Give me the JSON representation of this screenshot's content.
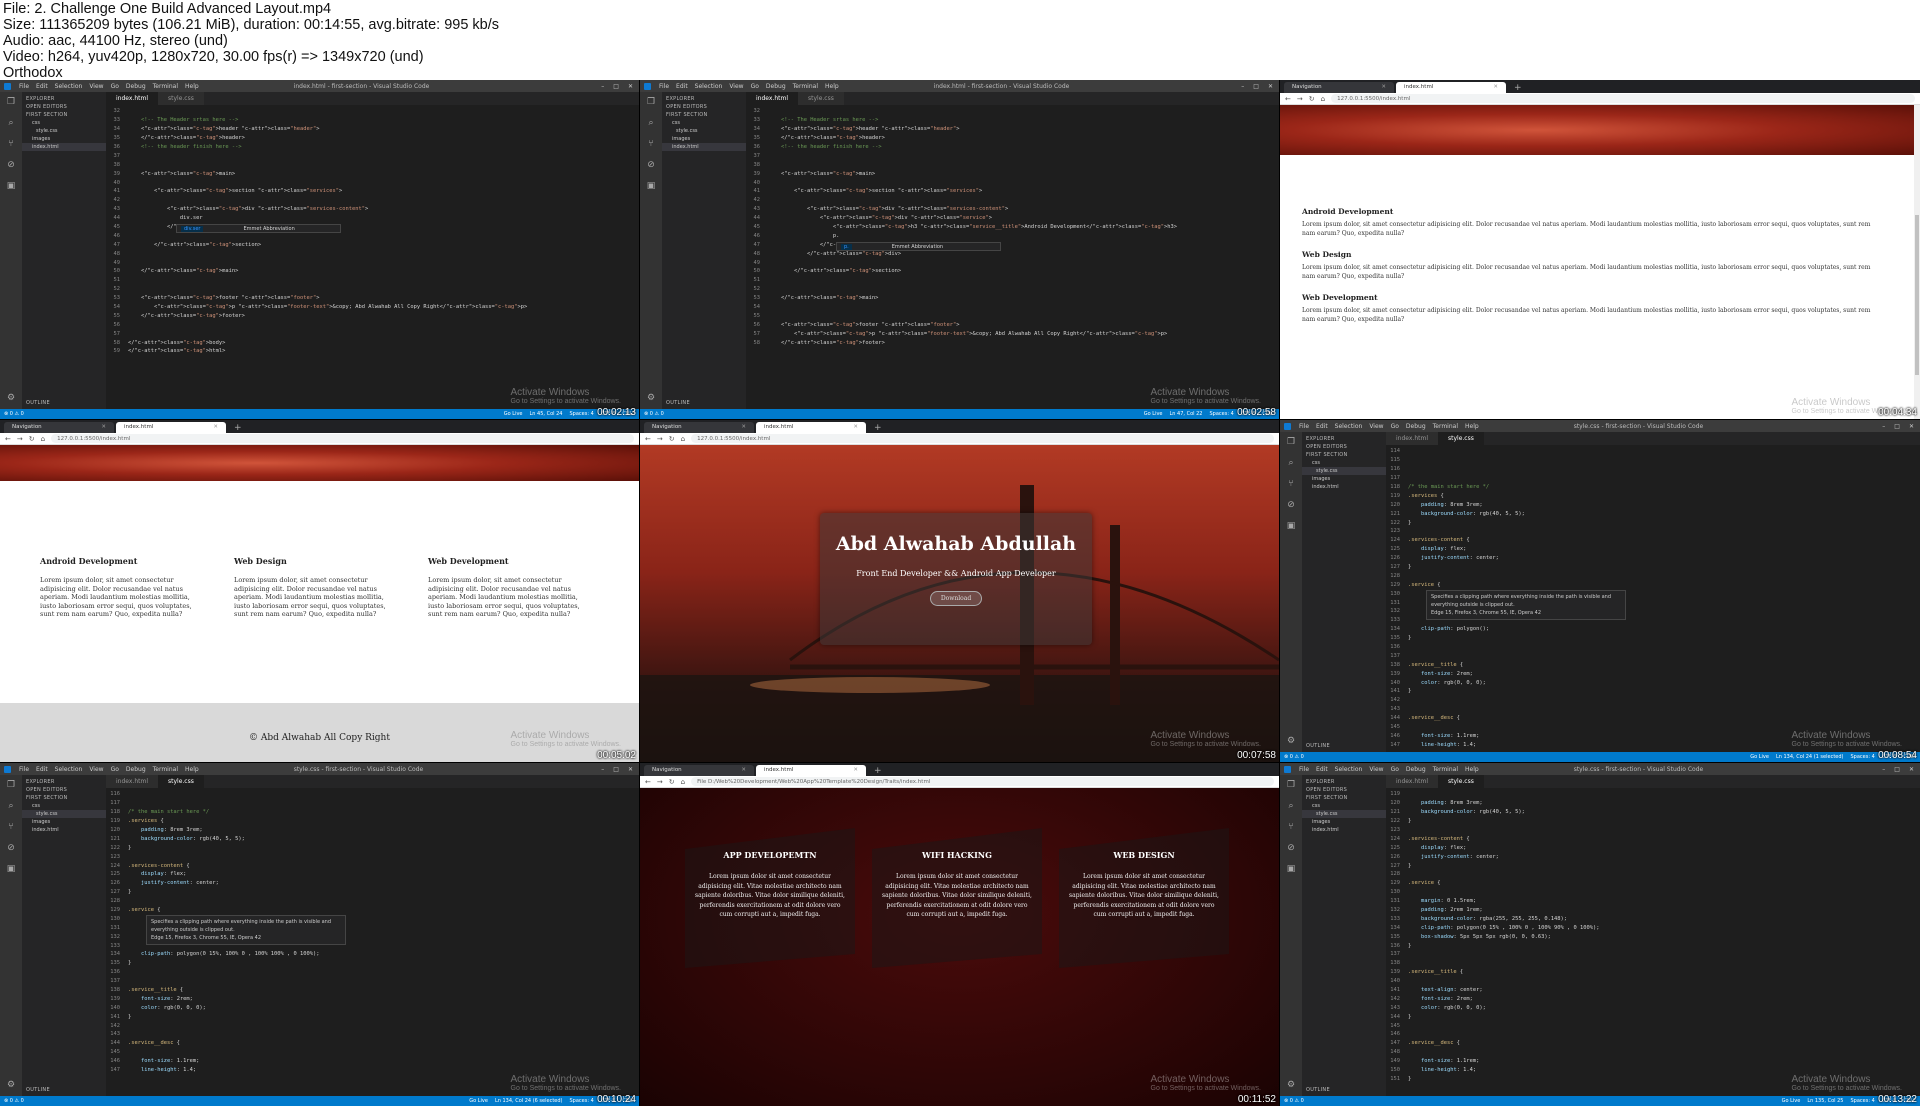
{
  "info": {
    "file": "File: 2. Challenge One Build Advanced Layout.mp4",
    "size": "Size: 111365209 bytes (106.21 MiB), duration: 00:14:55, avg.bitrate: 995 kb/s",
    "audio": "Audio: aac, 44100 Hz, stereo (und)",
    "video": "Video: h264, yuv420p, 1280x720, 30.00 fps(r) => 1349x720 (und)",
    "tag": "Orthodox"
  },
  "common": {
    "vs_menu": [
      "File",
      "Edit",
      "Selection",
      "View",
      "Go",
      "Debug",
      "Terminal",
      "Help"
    ],
    "vs_title_html": "index.html - first-section - Visual Studio Code",
    "vs_title_css": "style.css - first-section - Visual Studio Code",
    "win_controls": [
      "–",
      "□",
      "✕"
    ],
    "explorer": "EXPLORER",
    "open_editors": "OPEN EDITORS",
    "first_section": "FIRST SECTION",
    "css_folder": "css",
    "style_file": "style.css",
    "images_folder": "images",
    "index_file": "index.html",
    "outline": "OUTLINE",
    "tab_index": "index.html",
    "tab_style": "style.css",
    "status_left": "⊗ 0 ⚠ 0",
    "status_golive": "Go Live",
    "status_spaces": "Spaces: 4",
    "status_enc": "UTF-8",
    "status_eol": "CRLF",
    "activate_1": "Activate Windows",
    "activate_2": "Go to Settings to activate Windows.",
    "browser_tab_nav": "Navigation",
    "browser_tab_index": "index.html",
    "url_local": "127.0.0.1:5500/index.html",
    "url_file": "File  D:/Web%20Development/Web%20App%20Template%20Design/Traits/index.html",
    "nav_back": "←",
    "nav_fwd": "→",
    "nav_reload": "↻",
    "nav_home": "⌂",
    "new_tab": "+"
  },
  "timestamps": [
    "00:02:13",
    "00:02:58",
    "00:04:34",
    "00:05:02",
    "00:07:58",
    "00:08:54",
    "00:10:24",
    "00:11:52",
    "00:13:22"
  ],
  "status_cursor": [
    "Ln 45, Col 24",
    "Ln 47, Col 22",
    "Ln 134, Col 24 (1 selected)",
    "Ln 134, Col 24 (6 selected)",
    "Ln 135, Col 25"
  ],
  "editor1": {
    "lines": [
      {
        "n": "32",
        "t": ""
      },
      {
        "n": "33",
        "t": "    <!-- The Header srtas here -->"
      },
      {
        "n": "34",
        "t": "    <header class=\"header\">"
      },
      {
        "n": "35",
        "t": "    </header>"
      },
      {
        "n": "36",
        "t": "    <!-- the header finish here -->"
      },
      {
        "n": "37",
        "t": ""
      },
      {
        "n": "38",
        "t": ""
      },
      {
        "n": "39",
        "t": "    <main>"
      },
      {
        "n": "40",
        "t": ""
      },
      {
        "n": "41",
        "t": "        <section class=\"services\">"
      },
      {
        "n": "42",
        "t": ""
      },
      {
        "n": "43",
        "t": "            <div class=\"services-content\">"
      },
      {
        "n": "44",
        "t": "                div.ser"
      },
      {
        "n": "45",
        "t": "            </div>"
      },
      {
        "n": "46",
        "t": ""
      },
      {
        "n": "47",
        "t": "        </section>"
      },
      {
        "n": "48",
        "t": ""
      },
      {
        "n": "49",
        "t": ""
      },
      {
        "n": "50",
        "t": "    </main>"
      },
      {
        "n": "51",
        "t": ""
      },
      {
        "n": "52",
        "t": ""
      },
      {
        "n": "53",
        "t": "    <footer class=\"footer\">"
      },
      {
        "n": "54",
        "t": "        <p class=\"footer-text\">&copy; Abd Alwahab All Copy Right</p>"
      },
      {
        "n": "55",
        "t": "    </footer>"
      },
      {
        "n": "56",
        "t": ""
      },
      {
        "n": "57",
        "t": ""
      },
      {
        "n": "58",
        "t": "</body>"
      },
      {
        "n": "59",
        "t": "</html>"
      }
    ],
    "suggest_item": "div.ser",
    "suggest_type": "Emmet Abbreviation"
  },
  "editor2": {
    "lines": [
      {
        "n": "32",
        "t": ""
      },
      {
        "n": "33",
        "t": "    <!-- The Header srtas here -->"
      },
      {
        "n": "34",
        "t": "    <header class=\"header\">"
      },
      {
        "n": "35",
        "t": "    </header>"
      },
      {
        "n": "36",
        "t": "    <!-- the header finish here -->"
      },
      {
        "n": "37",
        "t": ""
      },
      {
        "n": "38",
        "t": ""
      },
      {
        "n": "39",
        "t": "    <main>"
      },
      {
        "n": "40",
        "t": ""
      },
      {
        "n": "41",
        "t": "        <section class=\"services\">"
      },
      {
        "n": "42",
        "t": ""
      },
      {
        "n": "43",
        "t": "            <div class=\"services-content\">"
      },
      {
        "n": "44",
        "t": "                <div class=\"service\">"
      },
      {
        "n": "45",
        "t": "                    <h3 class=\"service__title\">Android Development</h3>"
      },
      {
        "n": "46",
        "t": "                    p."
      },
      {
        "n": "47",
        "t": "                </div>"
      },
      {
        "n": "48",
        "t": "            </div>"
      },
      {
        "n": "49",
        "t": ""
      },
      {
        "n": "50",
        "t": "        </section>"
      },
      {
        "n": "51",
        "t": ""
      },
      {
        "n": "52",
        "t": ""
      },
      {
        "n": "53",
        "t": "    </main>"
      },
      {
        "n": "54",
        "t": ""
      },
      {
        "n": "55",
        "t": ""
      },
      {
        "n": "56",
        "t": "    <footer class=\"footer\">"
      },
      {
        "n": "57",
        "t": "        <p class=\"footer-text\">&copy; Abd Alwahab All Copy Right</p>"
      },
      {
        "n": "58",
        "t": "    </footer>"
      }
    ],
    "suggest_item": "p.",
    "suggest_type": "Emmet Abbreviation"
  },
  "editor6": {
    "lines": [
      {
        "n": "114",
        "t": ""
      },
      {
        "n": "115",
        "t": ""
      },
      {
        "n": "116",
        "t": ""
      },
      {
        "n": "117",
        "t": ""
      },
      {
        "n": "118",
        "t": "/* the main start here */"
      },
      {
        "n": "119",
        "t": ".services {"
      },
      {
        "n": "120",
        "t": "    padding: 8rem 3rem;"
      },
      {
        "n": "121",
        "t": "    background-color: rgb(40, 5, 5);"
      },
      {
        "n": "122",
        "t": "}"
      },
      {
        "n": "123",
        "t": ""
      },
      {
        "n": "124",
        "t": ".services-content {"
      },
      {
        "n": "125",
        "t": "    display: flex;"
      },
      {
        "n": "126",
        "t": "    justify-content: center;"
      },
      {
        "n": "127",
        "t": "}"
      },
      {
        "n": "128",
        "t": ""
      },
      {
        "n": "129",
        "t": ".service {"
      },
      {
        "n": "130",
        "t": ""
      },
      {
        "n": "131",
        "t": ""
      },
      {
        "n": "132",
        "t": ""
      },
      {
        "n": "133",
        "t": ""
      },
      {
        "n": "134",
        "t": "    clip-path: polygon();"
      },
      {
        "n": "135",
        "t": "}"
      },
      {
        "n": "136",
        "t": ""
      },
      {
        "n": "137",
        "t": ""
      },
      {
        "n": "138",
        "t": ".service__title {"
      },
      {
        "n": "139",
        "t": "    font-size: 2rem;"
      },
      {
        "n": "140",
        "t": "    color: rgb(0, 0, 0);"
      },
      {
        "n": "141",
        "t": "}"
      },
      {
        "n": "142",
        "t": ""
      },
      {
        "n": "143",
        "t": ""
      },
      {
        "n": "144",
        "t": ".service__desc {"
      },
      {
        "n": "145",
        "t": ""
      },
      {
        "n": "146",
        "t": "    font-size: 1.1rem;"
      },
      {
        "n": "147",
        "t": "    line-height: 1.4;"
      }
    ],
    "tip1": "Specifies a clipping path where everything inside the path is visible and everything outside is clipped out.",
    "tip2": "Edge 15, Firefox 3, Chrome 55, IE, Opera 42"
  },
  "editor7": {
    "lines": [
      {
        "n": "116",
        "t": ""
      },
      {
        "n": "117",
        "t": ""
      },
      {
        "n": "118",
        "t": "/* the main start here */"
      },
      {
        "n": "119",
        "t": ".services {"
      },
      {
        "n": "120",
        "t": "    padding: 8rem 3rem;"
      },
      {
        "n": "121",
        "t": "    background-color: rgb(40, 5, 5);"
      },
      {
        "n": "122",
        "t": "}"
      },
      {
        "n": "123",
        "t": ""
      },
      {
        "n": "124",
        "t": ".services-content {"
      },
      {
        "n": "125",
        "t": "    display: flex;"
      },
      {
        "n": "126",
        "t": "    justify-content: center;"
      },
      {
        "n": "127",
        "t": "}"
      },
      {
        "n": "128",
        "t": ""
      },
      {
        "n": "129",
        "t": ".service {"
      },
      {
        "n": "130",
        "t": ""
      },
      {
        "n": "131",
        "t": ""
      },
      {
        "n": "132",
        "t": ""
      },
      {
        "n": "133",
        "t": ""
      },
      {
        "n": "134",
        "t": "    clip-path: polygon(0 15%, 100% 0 , 100% 100% , 0 100%);"
      },
      {
        "n": "135",
        "t": "}"
      },
      {
        "n": "136",
        "t": ""
      },
      {
        "n": "137",
        "t": ""
      },
      {
        "n": "138",
        "t": ".service__title {"
      },
      {
        "n": "139",
        "t": "    font-size: 2rem;"
      },
      {
        "n": "140",
        "t": "    color: rgb(0, 0, 0);"
      },
      {
        "n": "141",
        "t": "}"
      },
      {
        "n": "142",
        "t": ""
      },
      {
        "n": "143",
        "t": ""
      },
      {
        "n": "144",
        "t": ".service__desc {"
      },
      {
        "n": "145",
        "t": ""
      },
      {
        "n": "146",
        "t": "    font-size: 1.1rem;"
      },
      {
        "n": "147",
        "t": "    line-height: 1.4;"
      }
    ],
    "tip1": "Specifies a clipping path where everything inside the path is visible and everything outside is clipped out.",
    "tip2": "Edge 15, Firefox 3, Chrome 55, IE, Opera 42"
  },
  "editor9": {
    "lines": [
      {
        "n": "119",
        "t": ""
      },
      {
        "n": "120",
        "t": "    padding: 8rem 3rem;"
      },
      {
        "n": "121",
        "t": "    background-color: rgb(40, 5, 5);"
      },
      {
        "n": "122",
        "t": "}"
      },
      {
        "n": "123",
        "t": ""
      },
      {
        "n": "124",
        "t": ".services-content {"
      },
      {
        "n": "125",
        "t": "    display: flex;"
      },
      {
        "n": "126",
        "t": "    justify-content: center;"
      },
      {
        "n": "127",
        "t": "}"
      },
      {
        "n": "128",
        "t": ""
      },
      {
        "n": "129",
        "t": ".service {"
      },
      {
        "n": "130",
        "t": ""
      },
      {
        "n": "131",
        "t": "    margin: 0 1.5rem;"
      },
      {
        "n": "132",
        "t": "    padding: 2rem 1rem;"
      },
      {
        "n": "133",
        "t": "    background-color: rgba(255, 255, 255, 0.148);"
      },
      {
        "n": "134",
        "t": "    clip-path: polygon(0 15% , 100% 0 , 100% 90% , 0 100%);"
      },
      {
        "n": "135",
        "t": "    box-shadow: 5px 5px 5px rgb(0, 0, 0.63);"
      },
      {
        "n": "136",
        "t": "}"
      },
      {
        "n": "137",
        "t": ""
      },
      {
        "n": "138",
        "t": ""
      },
      {
        "n": "139",
        "t": ".service__title {"
      },
      {
        "n": "140",
        "t": ""
      },
      {
        "n": "141",
        "t": "    text-align: center;"
      },
      {
        "n": "142",
        "t": "    font-size: 2rem;"
      },
      {
        "n": "143",
        "t": "    color: rgb(0, 0, 0);"
      },
      {
        "n": "144",
        "t": "}"
      },
      {
        "n": "145",
        "t": ""
      },
      {
        "n": "146",
        "t": ""
      },
      {
        "n": "147",
        "t": ".service__desc {"
      },
      {
        "n": "148",
        "t": ""
      },
      {
        "n": "149",
        "t": "    font-size: 1.1rem;"
      },
      {
        "n": "150",
        "t": "    line-height: 1.4;"
      },
      {
        "n": "151",
        "t": "}"
      }
    ]
  },
  "page3": {
    "services": [
      {
        "title": "Android Development",
        "desc": "Lorem ipsum dolor, sit amet consectetur adipisicing elit. Dolor recusandae vel natus aperiam. Modi laudantium molestias mollitia, iusto laboriosam error sequi, quos voluptates, sunt rem nam earum? Quo, expedita nulla?"
      },
      {
        "title": "Web Design",
        "desc": "Lorem ipsum dolor, sit amet consectetur adipisicing elit. Dolor recusandae vel natus aperiam. Modi laudantium molestias mollitia, iusto laboriosam error sequi, quos voluptates, sunt rem nam earum? Quo, expedita nulla?"
      },
      {
        "title": "Web Development",
        "desc": "Lorem ipsum dolor, sit amet consectetur adipisicing elit. Dolor recusandae vel natus aperiam. Modi laudantium molestias mollitia, iusto laboriosam error sequi, quos voluptates, sunt rem nam earum? Quo, expedita nulla?"
      }
    ]
  },
  "page4": {
    "services": [
      {
        "title": "Android Development",
        "desc": "Lorem ipsum dolor, sit amet consectetur adipisicing elit. Dolor recusandae vel natus aperiam. Modi laudantium molestias mollitia, iusto laboriosam error sequi, quos voluptates, sunt rem nam earum? Quo, expedita nulla?"
      },
      {
        "title": "Web Design",
        "desc": "Lorem ipsum dolor, sit amet consectetur adipisicing elit. Dolor recusandae vel natus aperiam. Modi laudantium molestias mollitia, iusto laboriosam error sequi, quos voluptates, sunt rem nam earum? Quo, expedita nulla?"
      },
      {
        "title": "Web Development",
        "desc": "Lorem ipsum dolor, sit amet consectetur adipisicing elit. Dolor recusandae vel natus aperiam. Modi laudantium molestias mollitia, iusto laboriosam error sequi, quos voluptates, sunt rem nam earum? Quo, expedita nulla?"
      }
    ],
    "footer": "© Abd Alwahab All Copy Right"
  },
  "page5": {
    "name": "Abd Alwahab Abdullah",
    "subtitle": "Front End Developer && Android App Developer",
    "button": "Download"
  },
  "page8": {
    "services": [
      {
        "title": "APP DEVELOPEMTN",
        "desc": "Lorem ipsum dolor sit amet consectetur adipisicing elit. Vitae molestiae architecto nam sapiente doloribus. Vitae dolor similique deleniti, perferendis exercitationem at odit dolore vero cum corrupti aut a, impedit fuga."
      },
      {
        "title": "WIFI HACKING",
        "desc": "Lorem ipsum dolor sit amet consectetur adipisicing elit. Vitae molestiae architecto nam sapiente doloribus. Vitae dolor similique deleniti, perferendis exercitationem at odit dolore vero cum corrupti aut a, impedit fuga."
      },
      {
        "title": "WEB DESIGN",
        "desc": "Lorem ipsum dolor sit amet consectetur adipisicing elit. Vitae molestiae architecto nam sapiente doloribus. Vitae dolor similique deleniti, perferendis exercitationem at odit dolore vero cum corrupti aut a, impedit fuga."
      }
    ]
  }
}
